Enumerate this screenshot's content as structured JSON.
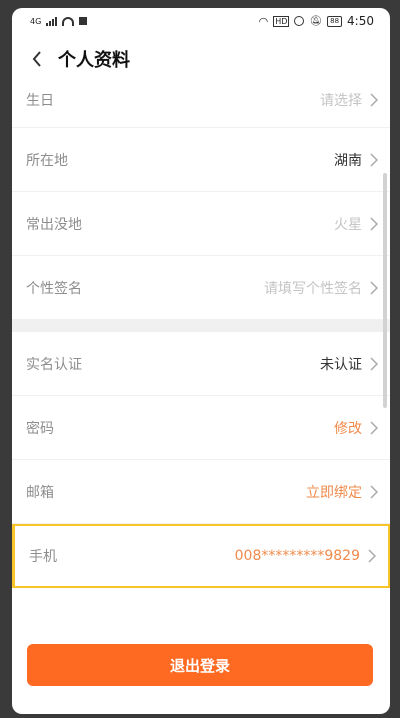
{
  "statusbar": {
    "network": "4G",
    "hd": "HD",
    "battery": "88",
    "time": "4:50"
  },
  "header": {
    "title": "个人资料"
  },
  "rows": [
    {
      "label": "生日",
      "value": "请选择",
      "color": "#c4c4c4"
    },
    {
      "label": "所在地",
      "value": "湖南",
      "color": "#333333"
    },
    {
      "label": "常出没地",
      "value": "火星",
      "color": "#c4c4c4"
    },
    {
      "label": "个性签名",
      "value": "请填写个性签名",
      "color": "#c4c4c4"
    },
    {
      "label": "实名认证",
      "value": "未认证",
      "color": "#333333"
    },
    {
      "label": "密码",
      "value": "修改",
      "color": "#f08a4a"
    },
    {
      "label": "邮箱",
      "value": "立即绑定",
      "color": "#f08a4a"
    },
    {
      "label": "手机",
      "value": "008*********9829",
      "color": "#f08a4a"
    }
  ],
  "logout_label": "退出登录",
  "colors": {
    "accent": "#ff6a22",
    "highlight_border": "#f7c42a"
  }
}
